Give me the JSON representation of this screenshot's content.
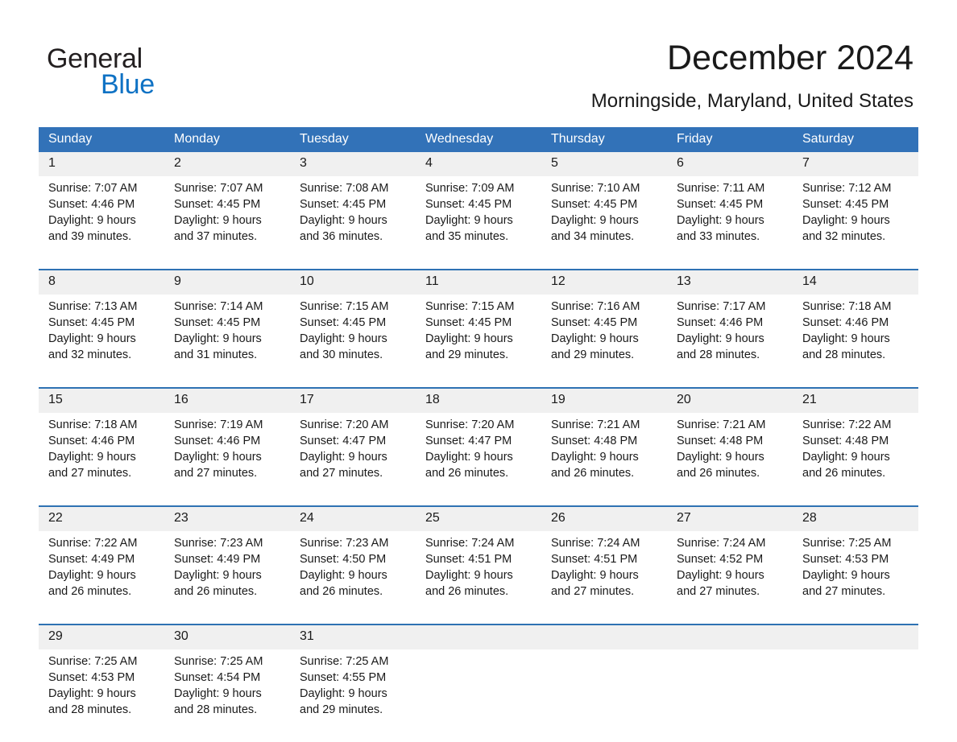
{
  "brand": {
    "name_part1": "General",
    "name_part2": "Blue",
    "triangle_color": "#1b6cb5",
    "blue_text_color": "#0f72c4"
  },
  "header": {
    "title": "December 2024",
    "location": "Morningside, Maryland, United States"
  },
  "theme": {
    "header_blue": "#3272b8",
    "rule_blue": "#2e72b3",
    "daynum_band": "#f0f0f0"
  },
  "weekday_headers": [
    "Sunday",
    "Monday",
    "Tuesday",
    "Wednesday",
    "Thursday",
    "Friday",
    "Saturday"
  ],
  "weeks": [
    {
      "days": [
        {
          "num": "1",
          "sunrise": "Sunrise: 7:07 AM",
          "sunset": "Sunset: 4:46 PM",
          "daylight_1": "Daylight: 9 hours",
          "daylight_2": "and 39 minutes."
        },
        {
          "num": "2",
          "sunrise": "Sunrise: 7:07 AM",
          "sunset": "Sunset: 4:45 PM",
          "daylight_1": "Daylight: 9 hours",
          "daylight_2": "and 37 minutes."
        },
        {
          "num": "3",
          "sunrise": "Sunrise: 7:08 AM",
          "sunset": "Sunset: 4:45 PM",
          "daylight_1": "Daylight: 9 hours",
          "daylight_2": "and 36 minutes."
        },
        {
          "num": "4",
          "sunrise": "Sunrise: 7:09 AM",
          "sunset": "Sunset: 4:45 PM",
          "daylight_1": "Daylight: 9 hours",
          "daylight_2": "and 35 minutes."
        },
        {
          "num": "5",
          "sunrise": "Sunrise: 7:10 AM",
          "sunset": "Sunset: 4:45 PM",
          "daylight_1": "Daylight: 9 hours",
          "daylight_2": "and 34 minutes."
        },
        {
          "num": "6",
          "sunrise": "Sunrise: 7:11 AM",
          "sunset": "Sunset: 4:45 PM",
          "daylight_1": "Daylight: 9 hours",
          "daylight_2": "and 33 minutes."
        },
        {
          "num": "7",
          "sunrise": "Sunrise: 7:12 AM",
          "sunset": "Sunset: 4:45 PM",
          "daylight_1": "Daylight: 9 hours",
          "daylight_2": "and 32 minutes."
        }
      ]
    },
    {
      "days": [
        {
          "num": "8",
          "sunrise": "Sunrise: 7:13 AM",
          "sunset": "Sunset: 4:45 PM",
          "daylight_1": "Daylight: 9 hours",
          "daylight_2": "and 32 minutes."
        },
        {
          "num": "9",
          "sunrise": "Sunrise: 7:14 AM",
          "sunset": "Sunset: 4:45 PM",
          "daylight_1": "Daylight: 9 hours",
          "daylight_2": "and 31 minutes."
        },
        {
          "num": "10",
          "sunrise": "Sunrise: 7:15 AM",
          "sunset": "Sunset: 4:45 PM",
          "daylight_1": "Daylight: 9 hours",
          "daylight_2": "and 30 minutes."
        },
        {
          "num": "11",
          "sunrise": "Sunrise: 7:15 AM",
          "sunset": "Sunset: 4:45 PM",
          "daylight_1": "Daylight: 9 hours",
          "daylight_2": "and 29 minutes."
        },
        {
          "num": "12",
          "sunrise": "Sunrise: 7:16 AM",
          "sunset": "Sunset: 4:45 PM",
          "daylight_1": "Daylight: 9 hours",
          "daylight_2": "and 29 minutes."
        },
        {
          "num": "13",
          "sunrise": "Sunrise: 7:17 AM",
          "sunset": "Sunset: 4:46 PM",
          "daylight_1": "Daylight: 9 hours",
          "daylight_2": "and 28 minutes."
        },
        {
          "num": "14",
          "sunrise": "Sunrise: 7:18 AM",
          "sunset": "Sunset: 4:46 PM",
          "daylight_1": "Daylight: 9 hours",
          "daylight_2": "and 28 minutes."
        }
      ]
    },
    {
      "days": [
        {
          "num": "15",
          "sunrise": "Sunrise: 7:18 AM",
          "sunset": "Sunset: 4:46 PM",
          "daylight_1": "Daylight: 9 hours",
          "daylight_2": "and 27 minutes."
        },
        {
          "num": "16",
          "sunrise": "Sunrise: 7:19 AM",
          "sunset": "Sunset: 4:46 PM",
          "daylight_1": "Daylight: 9 hours",
          "daylight_2": "and 27 minutes."
        },
        {
          "num": "17",
          "sunrise": "Sunrise: 7:20 AM",
          "sunset": "Sunset: 4:47 PM",
          "daylight_1": "Daylight: 9 hours",
          "daylight_2": "and 27 minutes."
        },
        {
          "num": "18",
          "sunrise": "Sunrise: 7:20 AM",
          "sunset": "Sunset: 4:47 PM",
          "daylight_1": "Daylight: 9 hours",
          "daylight_2": "and 26 minutes."
        },
        {
          "num": "19",
          "sunrise": "Sunrise: 7:21 AM",
          "sunset": "Sunset: 4:48 PM",
          "daylight_1": "Daylight: 9 hours",
          "daylight_2": "and 26 minutes."
        },
        {
          "num": "20",
          "sunrise": "Sunrise: 7:21 AM",
          "sunset": "Sunset: 4:48 PM",
          "daylight_1": "Daylight: 9 hours",
          "daylight_2": "and 26 minutes."
        },
        {
          "num": "21",
          "sunrise": "Sunrise: 7:22 AM",
          "sunset": "Sunset: 4:48 PM",
          "daylight_1": "Daylight: 9 hours",
          "daylight_2": "and 26 minutes."
        }
      ]
    },
    {
      "days": [
        {
          "num": "22",
          "sunrise": "Sunrise: 7:22 AM",
          "sunset": "Sunset: 4:49 PM",
          "daylight_1": "Daylight: 9 hours",
          "daylight_2": "and 26 minutes."
        },
        {
          "num": "23",
          "sunrise": "Sunrise: 7:23 AM",
          "sunset": "Sunset: 4:49 PM",
          "daylight_1": "Daylight: 9 hours",
          "daylight_2": "and 26 minutes."
        },
        {
          "num": "24",
          "sunrise": "Sunrise: 7:23 AM",
          "sunset": "Sunset: 4:50 PM",
          "daylight_1": "Daylight: 9 hours",
          "daylight_2": "and 26 minutes."
        },
        {
          "num": "25",
          "sunrise": "Sunrise: 7:24 AM",
          "sunset": "Sunset: 4:51 PM",
          "daylight_1": "Daylight: 9 hours",
          "daylight_2": "and 26 minutes."
        },
        {
          "num": "26",
          "sunrise": "Sunrise: 7:24 AM",
          "sunset": "Sunset: 4:51 PM",
          "daylight_1": "Daylight: 9 hours",
          "daylight_2": "and 27 minutes."
        },
        {
          "num": "27",
          "sunrise": "Sunrise: 7:24 AM",
          "sunset": "Sunset: 4:52 PM",
          "daylight_1": "Daylight: 9 hours",
          "daylight_2": "and 27 minutes."
        },
        {
          "num": "28",
          "sunrise": "Sunrise: 7:25 AM",
          "sunset": "Sunset: 4:53 PM",
          "daylight_1": "Daylight: 9 hours",
          "daylight_2": "and 27 minutes."
        }
      ]
    },
    {
      "days": [
        {
          "num": "29",
          "sunrise": "Sunrise: 7:25 AM",
          "sunset": "Sunset: 4:53 PM",
          "daylight_1": "Daylight: 9 hours",
          "daylight_2": "and 28 minutes."
        },
        {
          "num": "30",
          "sunrise": "Sunrise: 7:25 AM",
          "sunset": "Sunset: 4:54 PM",
          "daylight_1": "Daylight: 9 hours",
          "daylight_2": "and 28 minutes."
        },
        {
          "num": "31",
          "sunrise": "Sunrise: 7:25 AM",
          "sunset": "Sunset: 4:55 PM",
          "daylight_1": "Daylight: 9 hours",
          "daylight_2": "and 29 minutes."
        },
        {
          "num": "",
          "sunrise": "",
          "sunset": "",
          "daylight_1": "",
          "daylight_2": ""
        },
        {
          "num": "",
          "sunrise": "",
          "sunset": "",
          "daylight_1": "",
          "daylight_2": ""
        },
        {
          "num": "",
          "sunrise": "",
          "sunset": "",
          "daylight_1": "",
          "daylight_2": ""
        },
        {
          "num": "",
          "sunrise": "",
          "sunset": "",
          "daylight_1": "",
          "daylight_2": ""
        }
      ]
    }
  ]
}
